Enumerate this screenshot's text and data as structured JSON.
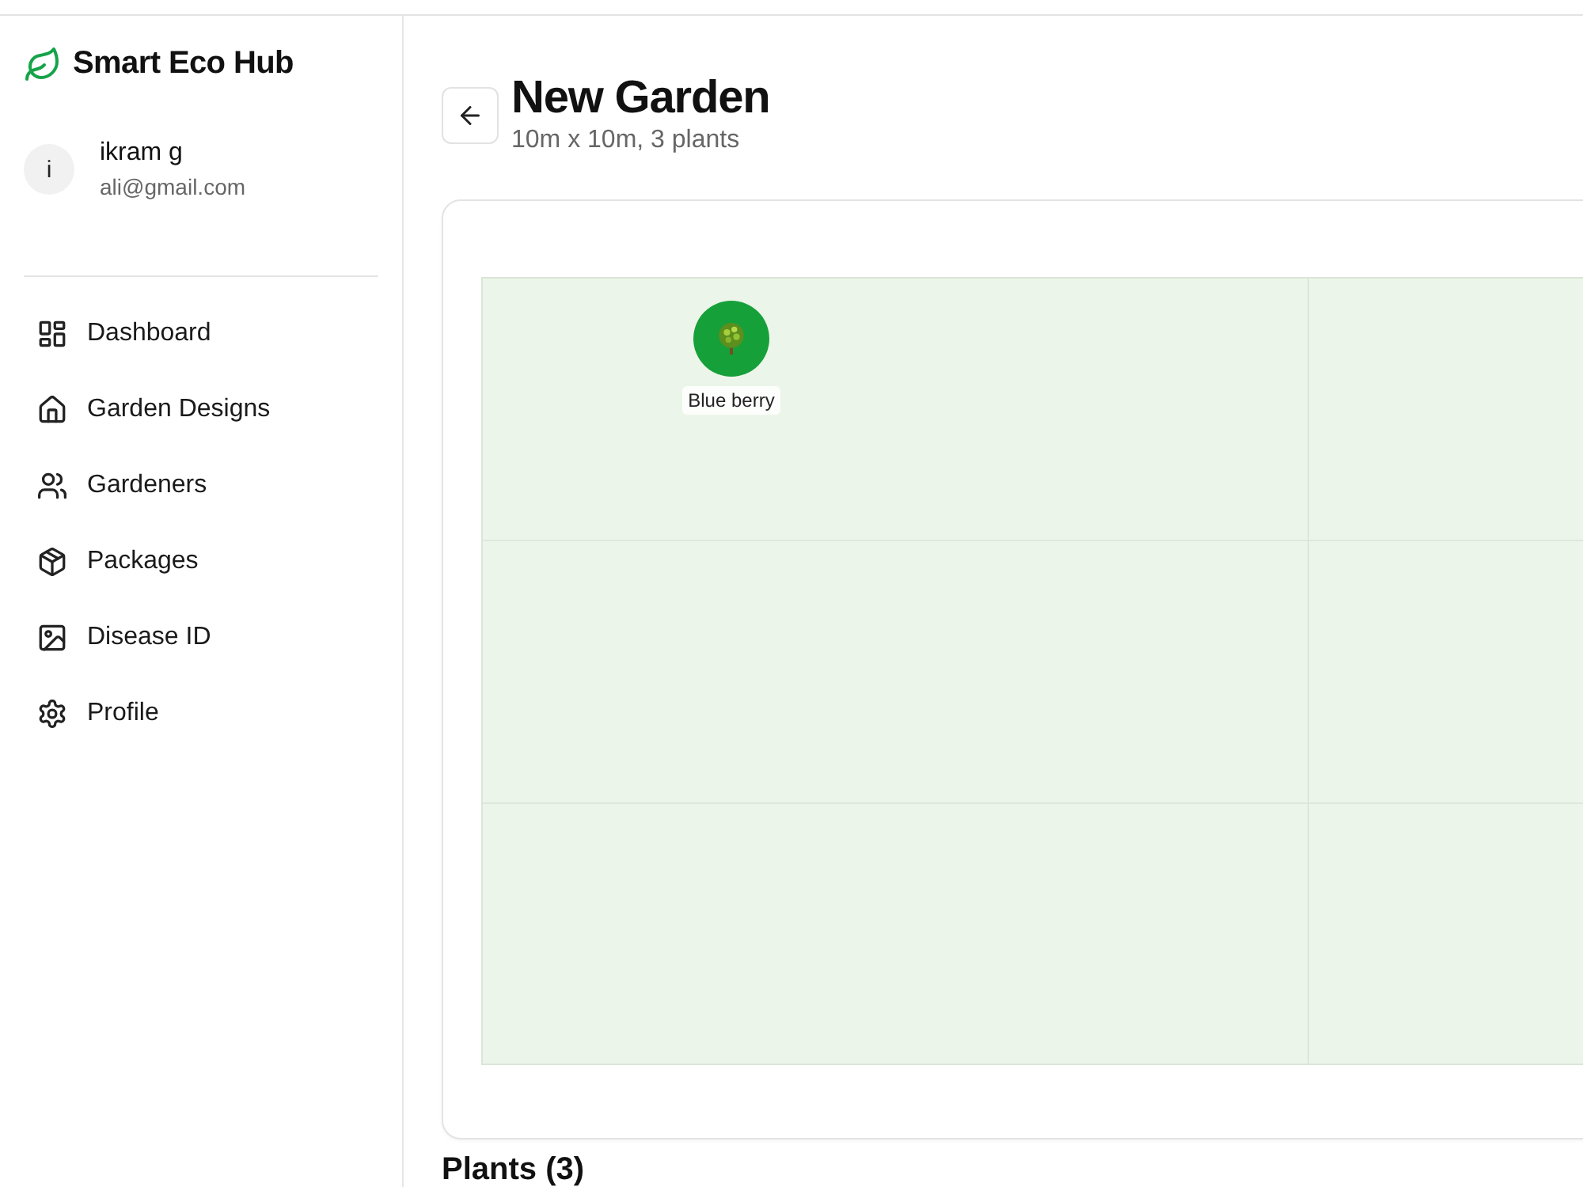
{
  "app": {
    "name": "Smart Eco Hub"
  },
  "user": {
    "initial": "i",
    "name": "ikram g",
    "email": "ali@gmail.com"
  },
  "sidebar": {
    "items": [
      {
        "label": "Dashboard",
        "selected": false
      },
      {
        "label": "Garden Designs",
        "selected": false
      },
      {
        "label": "Gardeners",
        "selected": false
      },
      {
        "label": "Packages",
        "selected": false
      },
      {
        "label": "Disease ID",
        "selected": false
      },
      {
        "label": "Profile",
        "selected": false
      }
    ]
  },
  "page": {
    "title": "New Garden",
    "subtitle": "10m x 10m, 3 plants"
  },
  "garden": {
    "plants": [
      {
        "name": "Blue berry"
      }
    ]
  },
  "plants_section": {
    "heading": "Plants (3)"
  }
}
